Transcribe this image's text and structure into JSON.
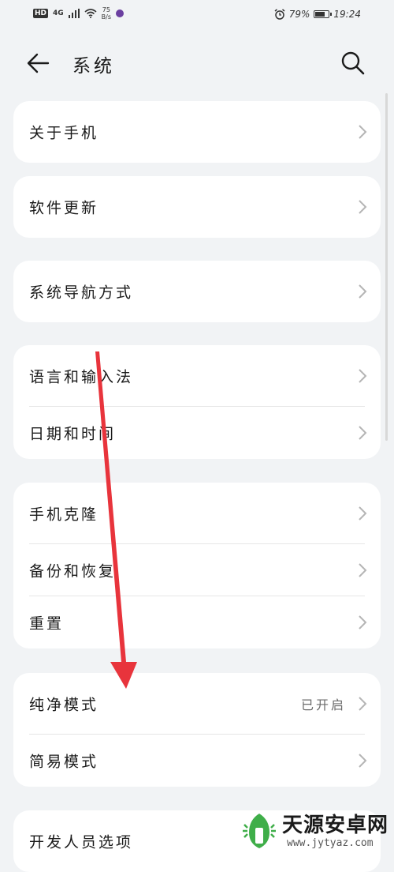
{
  "status_bar": {
    "hd": "HD",
    "network": "4G",
    "speed_value": "75",
    "speed_unit": "B/s",
    "battery_pct": "79%",
    "battery_level": 0.79,
    "time": "19:24"
  },
  "header": {
    "title": "系统",
    "back_icon": "back-arrow-icon",
    "search_icon": "search-icon"
  },
  "cards": [
    {
      "items": [
        {
          "label": "关于手机"
        }
      ]
    },
    {
      "items": [
        {
          "label": "软件更新"
        }
      ]
    },
    {
      "items": [
        {
          "label": "系统导航方式"
        }
      ]
    },
    {
      "items": [
        {
          "label": "语言和输入法"
        },
        {
          "label": "日期和时间"
        }
      ]
    },
    {
      "items": [
        {
          "label": "手机克隆"
        },
        {
          "label": "备份和恢复"
        },
        {
          "label": "重置"
        }
      ]
    },
    {
      "items": [
        {
          "label": "纯净模式",
          "value": "已开启"
        },
        {
          "label": "简易模式"
        }
      ]
    },
    {
      "items": [
        {
          "label": "开发人员选项"
        }
      ]
    }
  ],
  "watermark": {
    "name": "天源安卓网",
    "url": "www.jytyaz.com"
  },
  "colors": {
    "background": "#f1f3f5",
    "card": "#ffffff",
    "annotation_arrow": "#e8343c"
  }
}
